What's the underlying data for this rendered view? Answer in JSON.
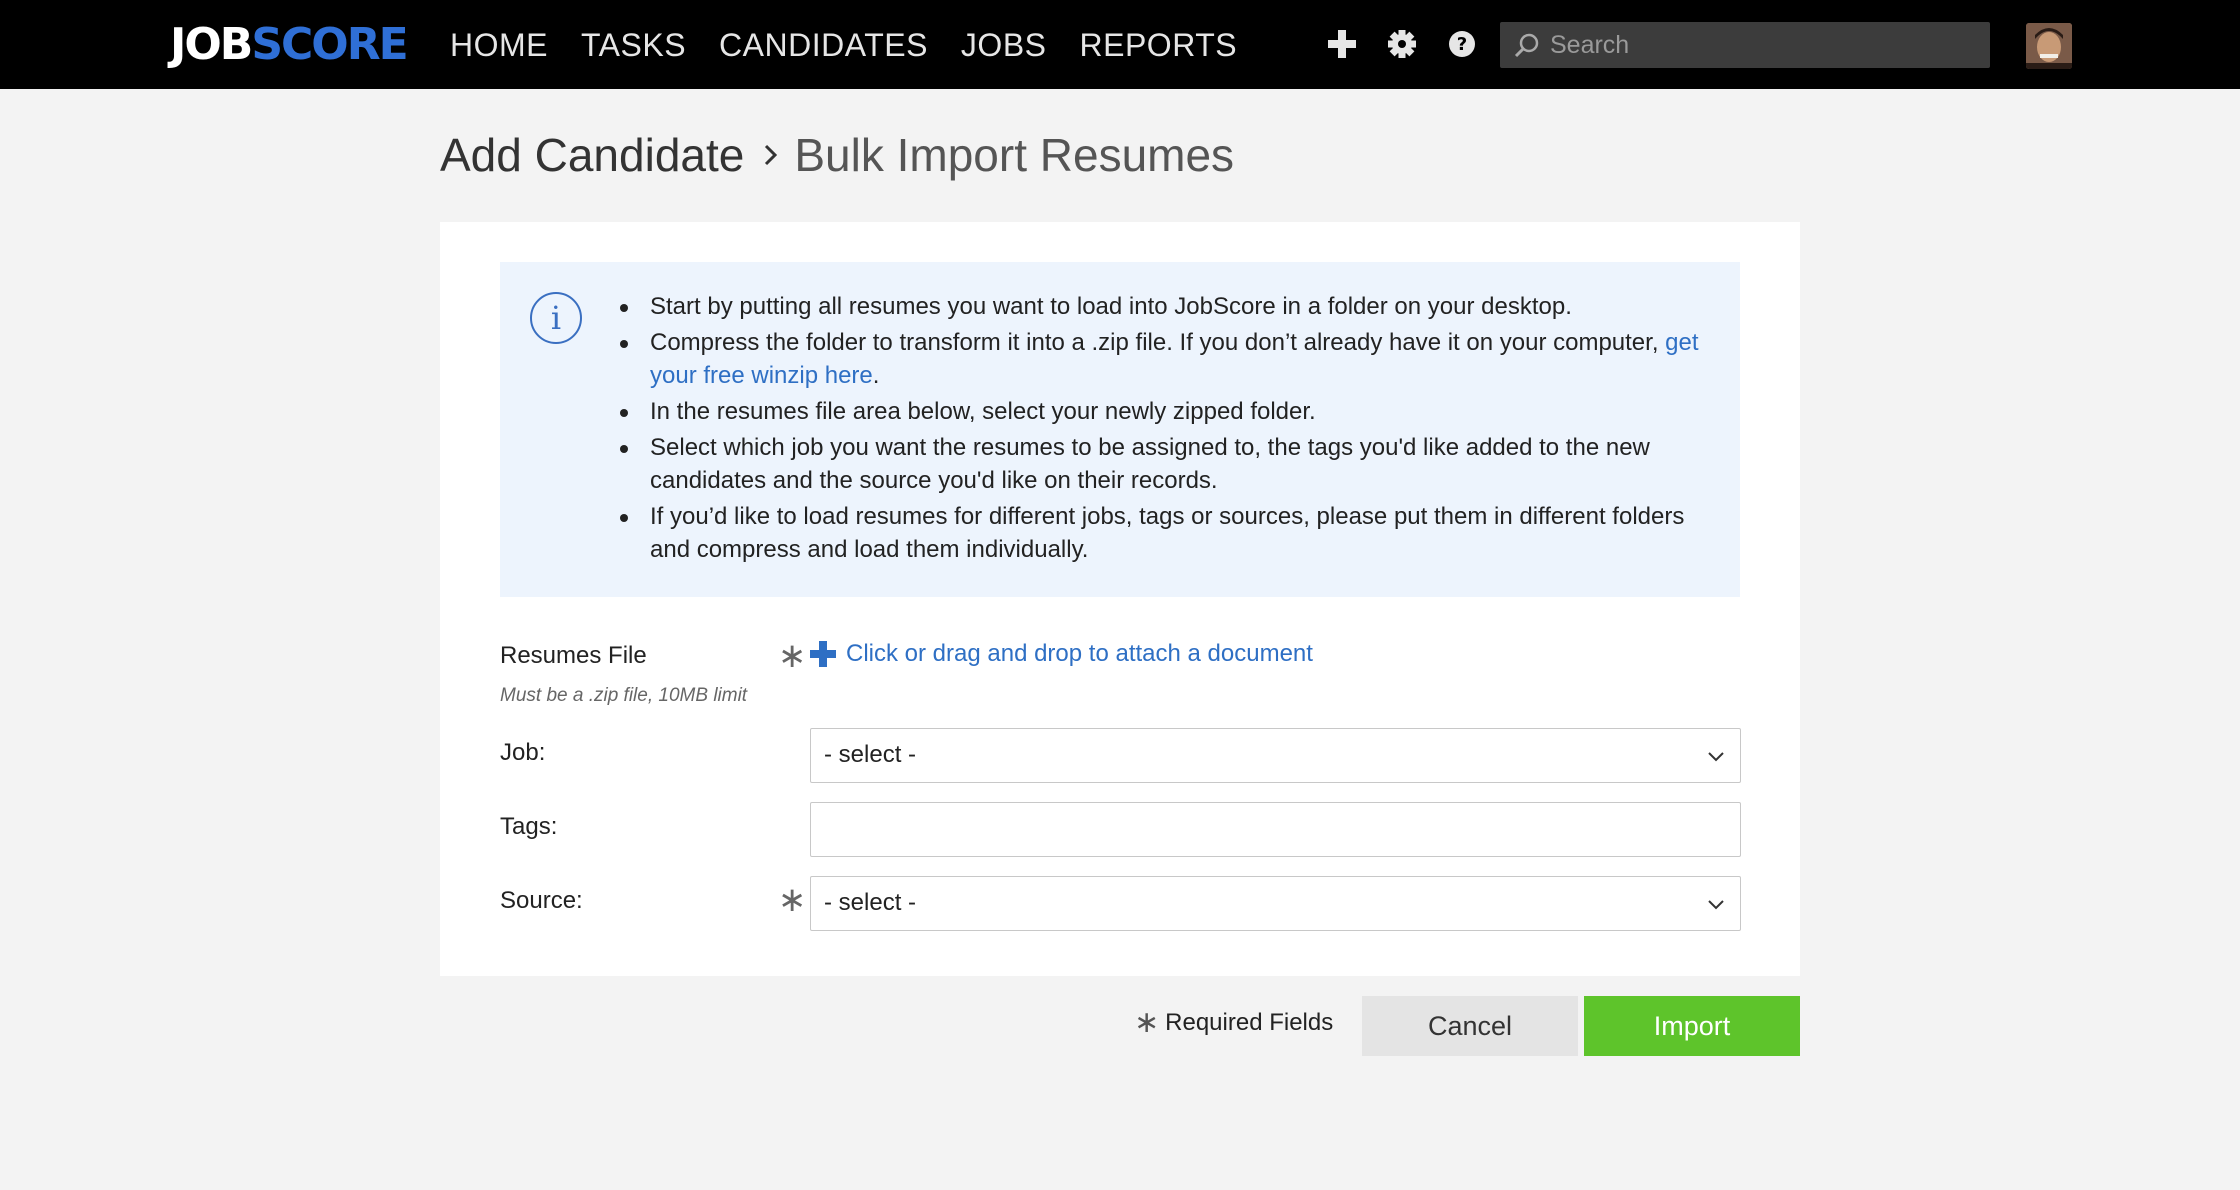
{
  "header": {
    "logo_job": "JOB",
    "logo_score": "SCORE",
    "nav": [
      {
        "label": "HOME"
      },
      {
        "label": "TASKS"
      },
      {
        "label": "CANDIDATES"
      },
      {
        "label": "JOBS"
      },
      {
        "label": "REPORTS"
      }
    ],
    "icons": [
      "plus-icon",
      "gear-icon",
      "help-icon"
    ],
    "search": {
      "placeholder": "Search",
      "value": ""
    }
  },
  "breadcrumb": {
    "parent": "Add Candidate",
    "current": "Bulk Import Resumes"
  },
  "info": {
    "items": [
      {
        "text": "Start by putting all resumes you want to load into JobScore in a folder on your desktop."
      },
      {
        "text": "Compress the folder to transform it into a .zip file. If you don’t already have it on your computer, ",
        "link": "get your free winzip here",
        "after": "."
      },
      {
        "text": "In the resumes file area below, select your newly zipped folder."
      },
      {
        "text": "Select which job you want the resumes to be assigned to, the tags you'd like added to the new candidates and the source you'd like on their records."
      },
      {
        "text": "If you’d like to load resumes for different jobs, tags or sources, please put them in different folders and compress and load them individually."
      }
    ]
  },
  "form": {
    "resumes_label": "Resumes File",
    "resumes_hint": "Must be a .zip file, 10MB limit",
    "attach_label": "Click or drag and drop to attach a document",
    "job_label": "Job:",
    "job_value": "- select -",
    "tags_label": "Tags:",
    "tags_value": "",
    "source_label": "Source:",
    "source_value": "- select -",
    "required_marker": "∗"
  },
  "footer": {
    "required_text": "Required Fields",
    "cancel_label": "Cancel",
    "import_label": "Import"
  },
  "colors": {
    "brand_blue": "#2f6fd6",
    "link_blue": "#2e6fc4",
    "import_green": "#5ec42b",
    "info_bg": "#edf4fd"
  }
}
